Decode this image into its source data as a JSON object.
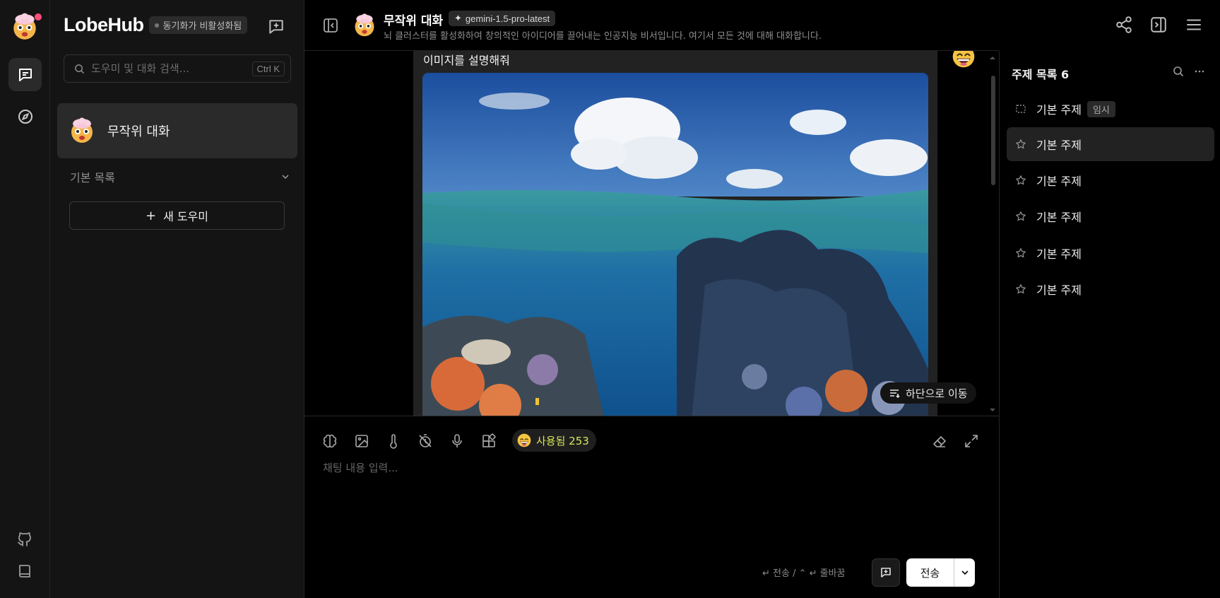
{
  "app": {
    "brand": "LobeHub",
    "sync_status": "동기화가 비활성화됨"
  },
  "sidebar": {
    "search_placeholder": "도우미 및 대화 검색...",
    "search_shortcut": "Ctrl K",
    "sessions": [
      {
        "label": "무작위 대화"
      }
    ],
    "group_label": "기본 목록",
    "new_agent_label": "새 도우미"
  },
  "chat": {
    "title": "무작위 대화",
    "model": "gemini-1.5-pro-latest",
    "description": "뇌 클러스터를 활성화하여 창의적인 아이디어를 끌어내는 인공지능 비서입니다. 여기서 모든 것에 대해 대화합니다.",
    "message_text": "이미지를 설명해줘",
    "image_icon": "underwater-coral-reef-image",
    "go_bottom_label": "하단으로 이동"
  },
  "input": {
    "usage_label": "사용됨 253",
    "placeholder": "채팅 내용 입력...",
    "hint": "↵ 전송 / ⌃ ↵ 줄바꿈",
    "send_label": "전송"
  },
  "topics": {
    "title": "주제 목록 6",
    "items": [
      {
        "label": "기본 주제",
        "tag": "임시"
      },
      {
        "label": "기본 주제"
      },
      {
        "label": "기본 주제"
      },
      {
        "label": "기본 주제"
      },
      {
        "label": "기본 주제"
      },
      {
        "label": "기본 주제"
      }
    ]
  },
  "colors": {
    "background": "#000000",
    "panel": "#141414",
    "active_item": "#2a2a2a",
    "usage_text": "#d9e85a",
    "notification_dot": "#ff4d7d"
  }
}
